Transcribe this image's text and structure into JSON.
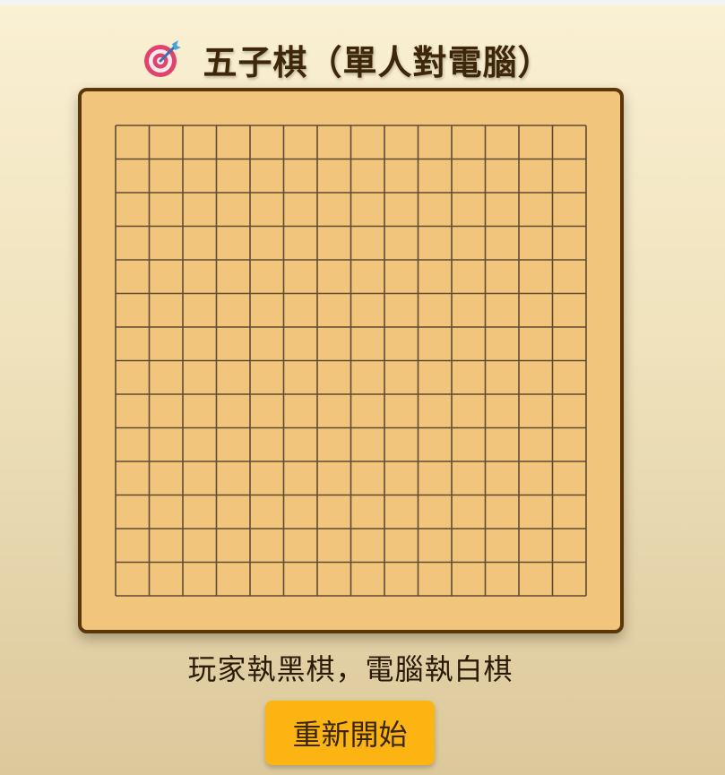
{
  "header": {
    "title": "五子棋（單人對電腦）",
    "icon": "dart-target-icon"
  },
  "board": {
    "size": 15,
    "stones": [],
    "colors": {
      "wood": "#f2c57c",
      "frame": "#5b3607",
      "line": "#5e4a34"
    }
  },
  "status": {
    "text": "玩家執黑棋，電腦執白棋"
  },
  "controls": {
    "restart_label": "重新開始"
  },
  "colors": {
    "title": "#3e2608",
    "button": "#fcb412"
  }
}
